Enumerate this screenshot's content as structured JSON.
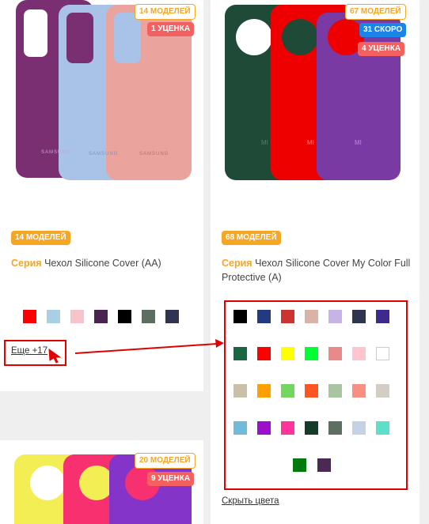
{
  "left_card": {
    "badge_models_img": "14 МОДЕЛЕЙ",
    "badge_markdown": "1 УЦЕНКА",
    "badge_models": "14 МОДЕЛЕЙ",
    "title_series": "Серия",
    "title_text": "Чехол Silicone Cover (AA)",
    "brand_label": "SAMSUNG",
    "swatches": [
      "#ff0000",
      "#a8cfe2",
      "#f8c4cc",
      "#4a2350",
      "#000000",
      "#5c6e60",
      "#2f3550"
    ],
    "more_link": "Еще +17",
    "phone_colors": [
      "#7a2f73",
      "#a9c2e8",
      "#eba39d"
    ]
  },
  "right_card": {
    "badge_models_img": "67 МОДЕЛЕЙ",
    "badge_soon": "31 СКОРО",
    "badge_markdown": "4 УЦЕНКА",
    "badge_models": "68 МОДЕЛЕЙ",
    "title_series": "Серия",
    "title_text": "Чехол Silicone Cover My Color Full Protective (A)",
    "brand_label": "MI",
    "phone_colors": [
      "#1f4a37",
      "#ee0000",
      "#7a3aa4"
    ],
    "swatches": [
      [
        "#000000",
        "#223a80",
        "#cc3333",
        "#d9b3a8",
        "#c8b3e6",
        "#2e3550",
        "#3d2a8c"
      ],
      [
        "#1a6640",
        "#ff0000",
        "#ffff00",
        "#00ff33",
        "#e88a8a",
        "#ffc4cc",
        "#ffffff"
      ],
      [
        "#c8c0a8",
        "#ffa000",
        "#72d660",
        "#ff5522",
        "#a8c4a0",
        "#f79080",
        "#d3cdc5"
      ],
      [
        "#70bcd8",
        "#9b10c8",
        "#ff3399",
        "#153c2a",
        "#5f6e62",
        "#c4d2e6",
        "#5ee0c8"
      ],
      [
        "#007a0a",
        "#4a2a55"
      ]
    ],
    "hide_link": "Скрыть цвета"
  },
  "bottom_card": {
    "badge_models_img": "20 МОДЕЛЕЙ",
    "badge_markdown": "9 УЦЕНКА",
    "phone_colors": [
      "#f4ee55",
      "#f73070",
      "#8434c8"
    ]
  },
  "annotation_color": "#e00000"
}
